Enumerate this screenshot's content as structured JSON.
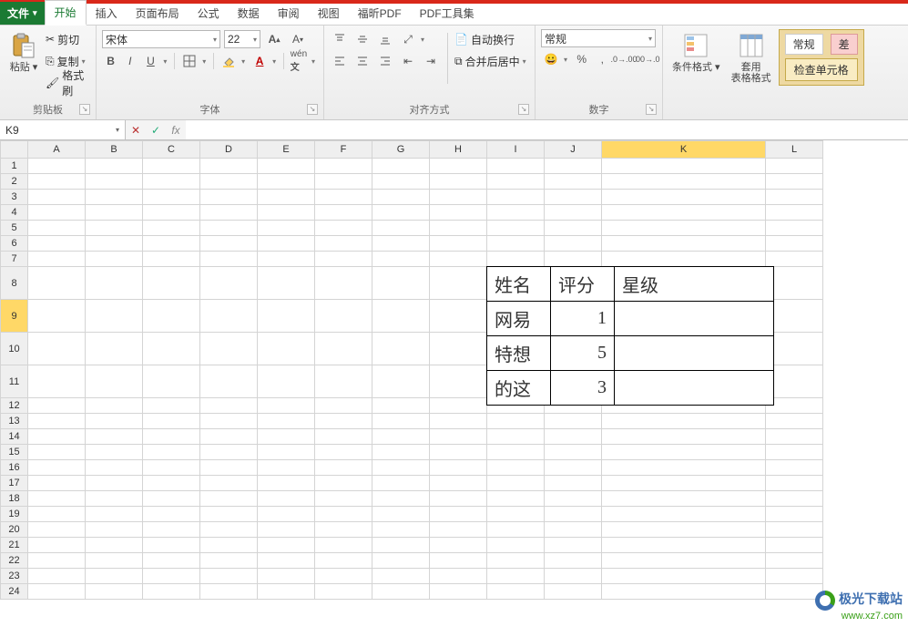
{
  "tabs": {
    "file": "文件",
    "home": "开始",
    "insert": "插入",
    "layout": "页面布局",
    "formula": "公式",
    "data": "数据",
    "review": "审阅",
    "view": "视图",
    "foxit": "福昕PDF",
    "pdftool": "PDF工具集"
  },
  "clipboard": {
    "paste": "粘贴",
    "cut": "剪切",
    "copy": "复制",
    "painter": "格式刷",
    "group": "剪贴板"
  },
  "font": {
    "name": "宋体",
    "size": "22",
    "group": "字体"
  },
  "align": {
    "wrap": "自动换行",
    "merge": "合并后居中",
    "group": "对齐方式"
  },
  "number": {
    "format": "常规",
    "group": "数字"
  },
  "styles": {
    "condfmt": "条件格式",
    "tablefmt": "套用\n表格格式",
    "catGeneral": "常规",
    "catBad": "差",
    "checkcell": "检查单元格"
  },
  "namebox": "K9",
  "formula": "",
  "columns": [
    "A",
    "B",
    "C",
    "D",
    "E",
    "F",
    "G",
    "H",
    "I",
    "J",
    "K",
    "L"
  ],
  "rowCount": 24,
  "selection": {
    "col": "K",
    "row": 9
  },
  "datatable": {
    "headers": [
      "姓名",
      "评分",
      "星级"
    ],
    "rows": [
      {
        "name": "网易",
        "score": "1",
        "star": ""
      },
      {
        "name": "特想",
        "score": "5",
        "star": ""
      },
      {
        "name": "的这",
        "score": "3",
        "star": ""
      }
    ]
  },
  "watermark": {
    "title": "极光下载站",
    "url": "www.xz7.com"
  },
  "colWidths": {
    "default": 63,
    "K": 180
  },
  "chart_data": null
}
